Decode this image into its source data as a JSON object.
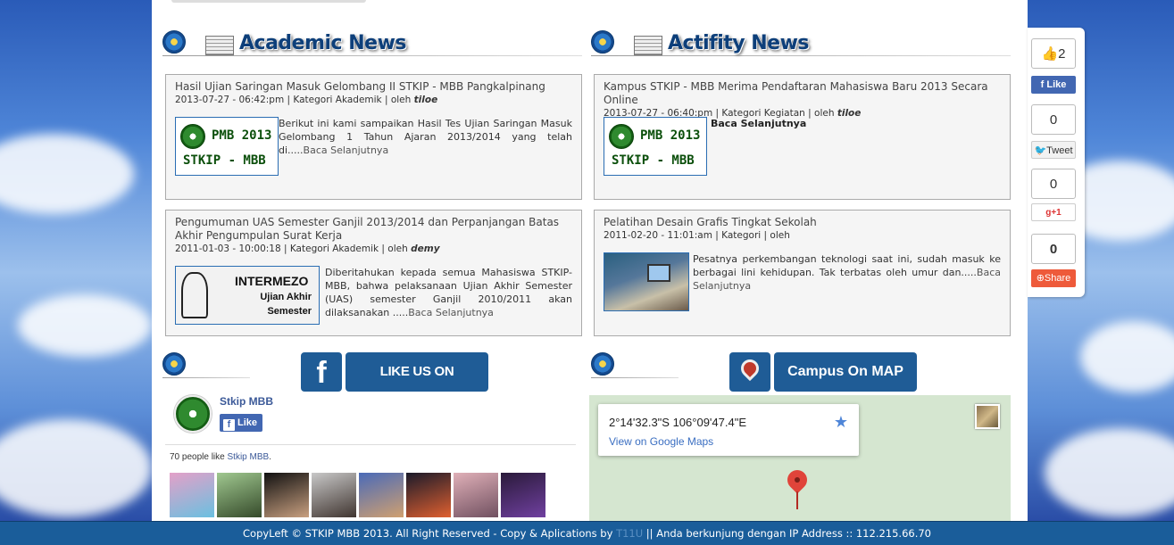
{
  "academic": {
    "title": "Academic News",
    "items": [
      {
        "title": "Hasil Ujian Saringan Masuk Gelombang II STKIP - MBB Pangkalpinang",
        "meta": "2013-07-27 - 06:42:pm | Kategori Akademik | oleh ",
        "author": "tiloe",
        "text": "Berikut ini kami sampaikan Hasil Tes Ujian Saringan Masuk Gelombang 1 Tahun Ajaran 2013/2014 yang telah di.....",
        "more": "Baca Selanjutnya",
        "thumb_line1": "PMB 2013",
        "thumb_line2": "STKIP - MBB"
      },
      {
        "title": "Pengumuman UAS Semester Ganjil 2013/2014 dan Perpanjangan Batas Akhir Pengumpulan Surat Kerja",
        "meta": "2011-01-03 - 10:00:18 | Kategori Akademik | oleh ",
        "author": "demy",
        "text": "Diberitahukan kepada semua Mahasiswa STKIP-MBB, bahwa pelaksanaan Ujian Akhir Semester (UAS) semester Ganjil 2010/2011 akan dilaksanakan .....",
        "more": "Baca Selanjutnya",
        "thumb_big": "INTERMEZO",
        "thumb_sub1": "Ujian Akhir",
        "thumb_sub2": "Semester"
      }
    ]
  },
  "activity": {
    "title": "Actifity News",
    "items": [
      {
        "title": "Kampus STKIP - MBB Merima Pendaftaran Mahasiswa Baru 2013 Secara Online",
        "meta": "2013-07-27 - 06:40:pm | Kategori Kegiatan | oleh ",
        "author": "tiloe",
        "more": "Baca Selanjutnya",
        "thumb_line1": "PMB 2013",
        "thumb_line2": "STKIP - MBB"
      },
      {
        "title": "Pelatihan Desain Grafis Tingkat Sekolah",
        "meta": "2011-02-20 - 11:01:am | Kategori | oleh",
        "text": "Pesatnya perkembangan teknologi saat ini, sudah masuk ke berbagai lini kehidupan. Tak terbatas oleh umur dan.....",
        "more": "Baca Selanjutnya"
      }
    ]
  },
  "facebook": {
    "button_letter": "f",
    "button_label": "LIKE US ON FACEBOOK",
    "page_name": "Stkip MBB",
    "like_label": "Like",
    "count_text": "70 people like ",
    "count_link": "Stkip MBB",
    "count_end": "."
  },
  "map": {
    "button_label": "Campus On MAP",
    "coord": "2°14'32.3\"S 106°09'47.4\"E",
    "link": "View on Google Maps",
    "star": "★"
  },
  "share": {
    "fb_count": "2",
    "fb_label": "Like",
    "tw_count": "0",
    "tw_label": "Tweet",
    "gp_count": "0",
    "gp_label": "g+1",
    "sh_count": "0",
    "sh_label": "Share"
  },
  "footer": {
    "prefix": "CopyLeft © STKIP MBB 2013. All Right Reserved - Copy & Aplications by ",
    "author": "T11U",
    "suffix": " || Anda berkunjung dengan IP Address :: 112.215.66.70"
  },
  "colors": {
    "footer_bg": "#1a5d9a",
    "button_bg": "#1f5c96",
    "facebook_blue": "#4267b2"
  }
}
